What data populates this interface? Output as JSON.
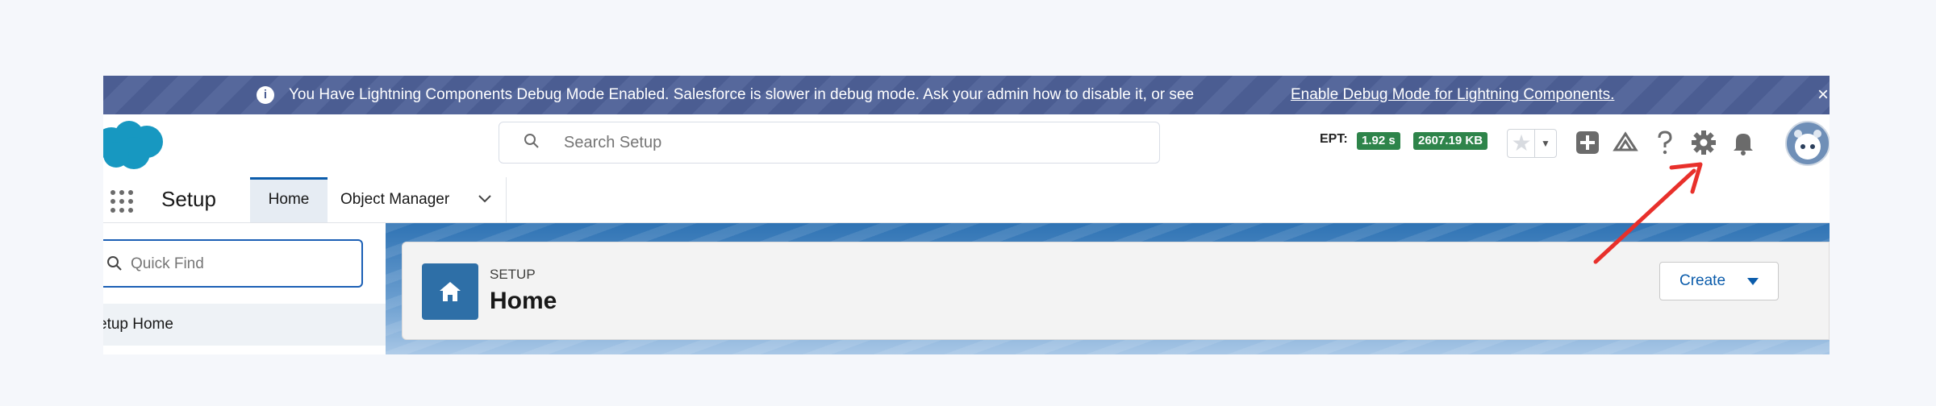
{
  "banner": {
    "icon": "info-icon",
    "message": "You Have Lightning Components Debug Mode Enabled. Salesforce is slower in debug mode. Ask your admin how to disable it, or see",
    "link_text": "Enable Debug Mode for Lightning Components.",
    "close_icon": "close-icon"
  },
  "header": {
    "logo": "salesforce-cloud-logo",
    "search_placeholder": "Search Setup",
    "ept_label": "EPT:",
    "ept_time": "1.92 s",
    "ept_size": "2607.19 KB",
    "icons": [
      "star-icon",
      "chevron-down-icon",
      "add-icon",
      "trailhead-icon",
      "help-icon",
      "gear-icon",
      "bell-icon",
      "avatar"
    ]
  },
  "nav": {
    "app_name": "Setup",
    "tabs": [
      {
        "label": "Home",
        "active": true
      },
      {
        "label": "Object Manager",
        "active": false
      }
    ]
  },
  "sidebar": {
    "quickfind_placeholder": "Quick Find",
    "items": [
      {
        "label": "etup Home"
      }
    ]
  },
  "page_header": {
    "eyebrow": "SETUP",
    "title": "Home",
    "create_label": "Create"
  },
  "colors": {
    "banner": "#4b5d92",
    "brand_blue": "#0b5cab",
    "ept_badge": "#2e844a",
    "annotation": "#e8302b"
  }
}
